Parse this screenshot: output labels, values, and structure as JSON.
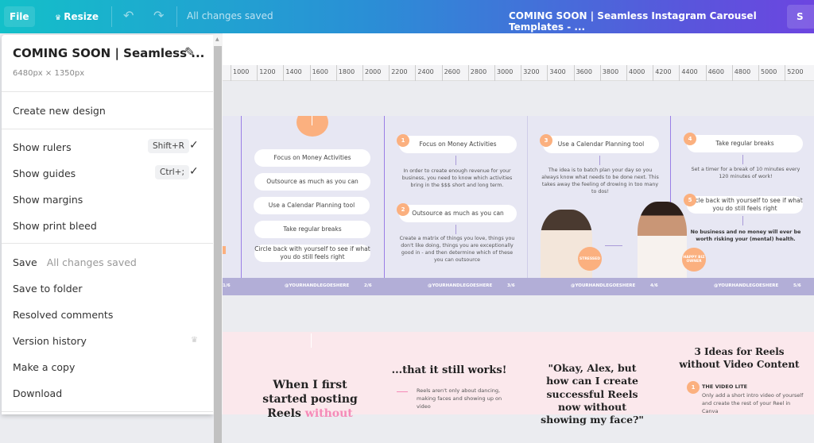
{
  "topbar": {
    "file": "File",
    "resize": "Resize",
    "saved": "All changes saved",
    "title": "COMING SOON | Seamless Instagram Carousel Templates - ...",
    "share": "S"
  },
  "ruler": [
    "1000",
    "1200",
    "1400",
    "1600",
    "1800",
    "2000",
    "2200",
    "2400",
    "2600",
    "2800",
    "3000",
    "3200",
    "3400",
    "3600",
    "3800",
    "4000",
    "4200",
    "4400",
    "4600",
    "4800",
    "5000",
    "5200"
  ],
  "menu": {
    "title": "COMING SOON | Seamless ...",
    "dimensions": "6480px × 1350px",
    "create": "Create new design",
    "show_rulers": "Show rulers",
    "rulers_kbd": "Shift+R",
    "show_guides": "Show guides",
    "guides_kbd": "Ctrl+;",
    "show_margins": "Show margins",
    "show_bleed": "Show print bleed",
    "save": "Save",
    "save_status": "All changes saved",
    "save_folder": "Save to folder",
    "resolved": "Resolved comments",
    "version": "Version history",
    "copy": "Make a copy",
    "download": "Download"
  },
  "slides": {
    "handle": "@YOURHANDLEGOESHERE",
    "p1": "1/6",
    "p2": "2/6",
    "p3": "3/6",
    "p4": "4/6",
    "p5": "5/6",
    "list": [
      "Focus on Money Activities",
      "Outsource as much as you can",
      "Use a Calendar Planning tool",
      "Take regular breaks",
      "Circle back with yourself to see if what you do still feels right"
    ],
    "nums": [
      "1",
      "2",
      "3",
      "4",
      "5"
    ],
    "d1": "In order to create enough revenue for your business, you need to know which activities bring in the $$$ short and long term.",
    "d2": "Create a matrix of things you love, things you don't like doing, things you are exceptionally good in - and then determine which of these you can outsource",
    "d3": "The idea is to batch plan your day so you always know what needs to be done next. This takes away the feeling of drowing in too many to dos!",
    "d4": "Set a timer for a break of 10 minutes every 120 minutes of work!",
    "d5": "No business and no money will ever be worth risking your (mental) health.",
    "stressed": "STRESSED",
    "happy": "HAPPY BIZ OWNER"
  },
  "reels": {
    "h1a": "When I first started posting",
    "h1b": "Reels",
    "h1c": "without",
    "h2": "...that it still works!",
    "t2": "Reels aren't only about dancing, making faces and showing up on video",
    "h3": "\"Okay, Alex, but how can I create successful Reels now without showing my face?\"",
    "h4": "3 Ideas for Reels without Video Content",
    "n1": "1",
    "idea1": "THE VIDEO LITE",
    "idea1_text": "Only add a short intro video of yourself and create the rest of your Reel in Canva"
  },
  "colors": {
    "accent": "#fbb07f",
    "lavender": "#e7e7f3",
    "footer": "#b2aed7",
    "pink": "#fbe8ec",
    "highlight": "#f58ab8"
  }
}
